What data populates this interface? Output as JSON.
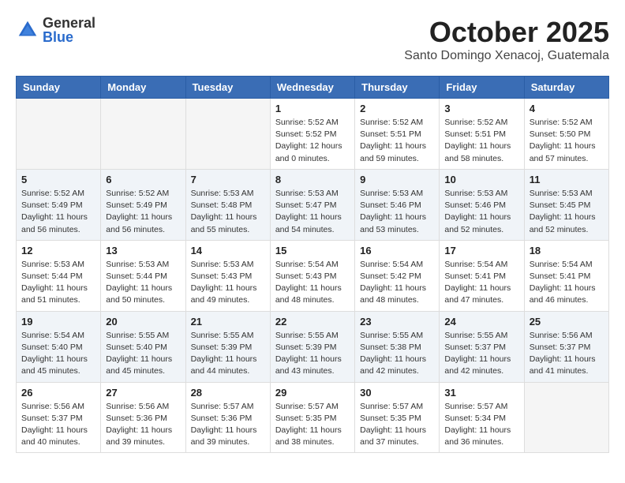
{
  "header": {
    "logo_general": "General",
    "logo_blue": "Blue",
    "month_title": "October 2025",
    "subtitle": "Santo Domingo Xenacoj, Guatemala"
  },
  "weekdays": [
    "Sunday",
    "Monday",
    "Tuesday",
    "Wednesday",
    "Thursday",
    "Friday",
    "Saturday"
  ],
  "weeks": [
    [
      {
        "day": "",
        "info": ""
      },
      {
        "day": "",
        "info": ""
      },
      {
        "day": "",
        "info": ""
      },
      {
        "day": "1",
        "info": "Sunrise: 5:52 AM\nSunset: 5:52 PM\nDaylight: 12 hours\nand 0 minutes."
      },
      {
        "day": "2",
        "info": "Sunrise: 5:52 AM\nSunset: 5:51 PM\nDaylight: 11 hours\nand 59 minutes."
      },
      {
        "day": "3",
        "info": "Sunrise: 5:52 AM\nSunset: 5:51 PM\nDaylight: 11 hours\nand 58 minutes."
      },
      {
        "day": "4",
        "info": "Sunrise: 5:52 AM\nSunset: 5:50 PM\nDaylight: 11 hours\nand 57 minutes."
      }
    ],
    [
      {
        "day": "5",
        "info": "Sunrise: 5:52 AM\nSunset: 5:49 PM\nDaylight: 11 hours\nand 56 minutes."
      },
      {
        "day": "6",
        "info": "Sunrise: 5:52 AM\nSunset: 5:49 PM\nDaylight: 11 hours\nand 56 minutes."
      },
      {
        "day": "7",
        "info": "Sunrise: 5:53 AM\nSunset: 5:48 PM\nDaylight: 11 hours\nand 55 minutes."
      },
      {
        "day": "8",
        "info": "Sunrise: 5:53 AM\nSunset: 5:47 PM\nDaylight: 11 hours\nand 54 minutes."
      },
      {
        "day": "9",
        "info": "Sunrise: 5:53 AM\nSunset: 5:46 PM\nDaylight: 11 hours\nand 53 minutes."
      },
      {
        "day": "10",
        "info": "Sunrise: 5:53 AM\nSunset: 5:46 PM\nDaylight: 11 hours\nand 52 minutes."
      },
      {
        "day": "11",
        "info": "Sunrise: 5:53 AM\nSunset: 5:45 PM\nDaylight: 11 hours\nand 52 minutes."
      }
    ],
    [
      {
        "day": "12",
        "info": "Sunrise: 5:53 AM\nSunset: 5:44 PM\nDaylight: 11 hours\nand 51 minutes."
      },
      {
        "day": "13",
        "info": "Sunrise: 5:53 AM\nSunset: 5:44 PM\nDaylight: 11 hours\nand 50 minutes."
      },
      {
        "day": "14",
        "info": "Sunrise: 5:53 AM\nSunset: 5:43 PM\nDaylight: 11 hours\nand 49 minutes."
      },
      {
        "day": "15",
        "info": "Sunrise: 5:54 AM\nSunset: 5:43 PM\nDaylight: 11 hours\nand 48 minutes."
      },
      {
        "day": "16",
        "info": "Sunrise: 5:54 AM\nSunset: 5:42 PM\nDaylight: 11 hours\nand 48 minutes."
      },
      {
        "day": "17",
        "info": "Sunrise: 5:54 AM\nSunset: 5:41 PM\nDaylight: 11 hours\nand 47 minutes."
      },
      {
        "day": "18",
        "info": "Sunrise: 5:54 AM\nSunset: 5:41 PM\nDaylight: 11 hours\nand 46 minutes."
      }
    ],
    [
      {
        "day": "19",
        "info": "Sunrise: 5:54 AM\nSunset: 5:40 PM\nDaylight: 11 hours\nand 45 minutes."
      },
      {
        "day": "20",
        "info": "Sunrise: 5:55 AM\nSunset: 5:40 PM\nDaylight: 11 hours\nand 45 minutes."
      },
      {
        "day": "21",
        "info": "Sunrise: 5:55 AM\nSunset: 5:39 PM\nDaylight: 11 hours\nand 44 minutes."
      },
      {
        "day": "22",
        "info": "Sunrise: 5:55 AM\nSunset: 5:39 PM\nDaylight: 11 hours\nand 43 minutes."
      },
      {
        "day": "23",
        "info": "Sunrise: 5:55 AM\nSunset: 5:38 PM\nDaylight: 11 hours\nand 42 minutes."
      },
      {
        "day": "24",
        "info": "Sunrise: 5:55 AM\nSunset: 5:37 PM\nDaylight: 11 hours\nand 42 minutes."
      },
      {
        "day": "25",
        "info": "Sunrise: 5:56 AM\nSunset: 5:37 PM\nDaylight: 11 hours\nand 41 minutes."
      }
    ],
    [
      {
        "day": "26",
        "info": "Sunrise: 5:56 AM\nSunset: 5:37 PM\nDaylight: 11 hours\nand 40 minutes."
      },
      {
        "day": "27",
        "info": "Sunrise: 5:56 AM\nSunset: 5:36 PM\nDaylight: 11 hours\nand 39 minutes."
      },
      {
        "day": "28",
        "info": "Sunrise: 5:57 AM\nSunset: 5:36 PM\nDaylight: 11 hours\nand 39 minutes."
      },
      {
        "day": "29",
        "info": "Sunrise: 5:57 AM\nSunset: 5:35 PM\nDaylight: 11 hours\nand 38 minutes."
      },
      {
        "day": "30",
        "info": "Sunrise: 5:57 AM\nSunset: 5:35 PM\nDaylight: 11 hours\nand 37 minutes."
      },
      {
        "day": "31",
        "info": "Sunrise: 5:57 AM\nSunset: 5:34 PM\nDaylight: 11 hours\nand 36 minutes."
      },
      {
        "day": "",
        "info": ""
      }
    ]
  ]
}
